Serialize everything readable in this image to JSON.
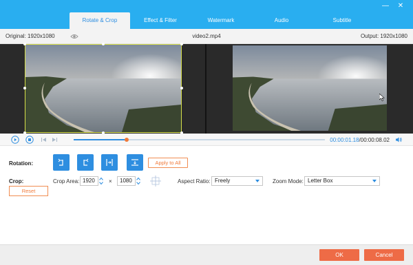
{
  "window": {
    "minimize_glyph": "—",
    "close_glyph": "✕"
  },
  "tabs": [
    {
      "label": "Rotate & Crop",
      "active": true
    },
    {
      "label": "Effect & Filter",
      "active": false
    },
    {
      "label": "Watermark",
      "active": false
    },
    {
      "label": "Audio",
      "active": false
    },
    {
      "label": "Subtitle",
      "active": false
    }
  ],
  "infobar": {
    "original": "Original: 1920x1080",
    "filename": "video2.mp4",
    "output": "Output: 1920x1080"
  },
  "playback": {
    "progress": 0.21,
    "current_time": "00:00:01.18",
    "total_time": "/00:00:08.02"
  },
  "rotation": {
    "label": "Rotation:",
    "apply_all": "Apply to All",
    "buttons": [
      "rotate-left-icon",
      "rotate-right-icon",
      "flip-horizontal-icon",
      "flip-vertical-icon"
    ]
  },
  "crop": {
    "label": "Crop:",
    "area_label": "Crop Area:",
    "width": "1920",
    "height": "1080",
    "times": "×",
    "aspect_label": "Aspect Ratio:",
    "aspect_value": "Freely",
    "zoom_label": "Zoom Mode:",
    "zoom_value": "Letter Box",
    "reset": "Reset"
  },
  "footer": {
    "ok": "OK",
    "cancel": "Cancel"
  },
  "colors": {
    "accent_blue": "#29aef0",
    "orange": "#ee6b46",
    "crop_outline": "#d8e04a"
  }
}
